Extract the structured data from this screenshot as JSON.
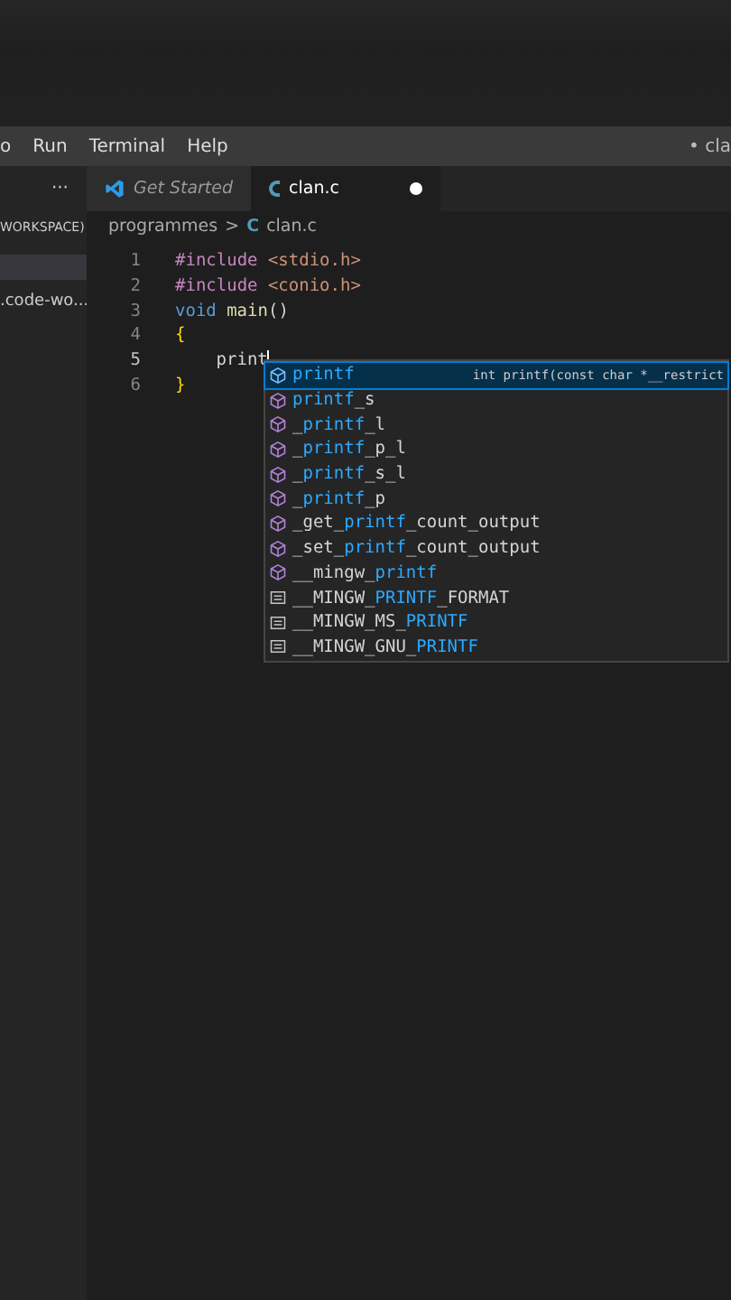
{
  "menu_bar": {
    "items": [
      "o",
      "Run",
      "Terminal",
      "Help"
    ],
    "title": "• cla"
  },
  "tabs": [
    {
      "label": "Get Started",
      "kind": "welcome",
      "selected": false,
      "dirty": false
    },
    {
      "label": "clan.c",
      "kind": "file",
      "selected": true,
      "dirty": true
    }
  ],
  "sidebar": {
    "items": [
      {
        "label": "WORKSPACE)",
        "selected": false
      },
      {
        "selected": true
      },
      {
        "label": ".code-wo...",
        "selected": false
      }
    ],
    "more": "···"
  },
  "breadcrumb": {
    "folder": "programmes",
    "separator": ">",
    "file_icon": "C",
    "file": "clan.c"
  },
  "editor": {
    "lines": [
      {
        "number": "1",
        "active": false,
        "tokens": [
          {
            "kind": "directive",
            "text": "#include"
          },
          {
            "kind": "string",
            "text": "<stdio.h>",
            "space_before": true
          }
        ]
      },
      {
        "number": "2",
        "active": false,
        "tokens": [
          {
            "kind": "directive",
            "text": "#include"
          },
          {
            "kind": "string",
            "text": "<conio.h>",
            "space_before": true
          }
        ]
      },
      {
        "number": "3",
        "active": false,
        "tokens": [
          {
            "kind": "keyword",
            "text": "void"
          },
          {
            "kind": "function",
            "text": "main",
            "space_before": true
          },
          {
            "kind": "text",
            "text": "()"
          }
        ]
      },
      {
        "number": "4",
        "active": false,
        "tokens": [
          {
            "kind": "bracket",
            "text": "{"
          }
        ]
      },
      {
        "number": "5",
        "active": true,
        "tokens": [
          {
            "kind": "text",
            "text": "print",
            "indent": true
          }
        ]
      },
      {
        "number": "6",
        "active": false,
        "tokens": [
          {
            "kind": "bracket",
            "text": "}"
          }
        ]
      }
    ]
  },
  "suggestions": {
    "detail": "int printf(const char *__restrict",
    "items": [
      {
        "kind": "method",
        "match": "printf",
        "selected": true
      },
      {
        "kind": "method",
        "match": "printf",
        "after": "_s",
        "selected": false
      },
      {
        "kind": "method",
        "before": "_",
        "match": "printf",
        "after": "_l",
        "selected": false
      },
      {
        "kind": "method",
        "before": "_",
        "match": "printf",
        "after": "_p_l",
        "selected": false
      },
      {
        "kind": "method",
        "before": "_",
        "match": "printf",
        "after": "_s_l",
        "selected": false
      },
      {
        "kind": "method",
        "before": "_",
        "match": "printf",
        "after": "_p",
        "selected": false
      },
      {
        "kind": "method",
        "before": "_get_",
        "match": "printf",
        "after": "_count_output",
        "selected": false
      },
      {
        "kind": "method",
        "before": "_set_",
        "match": "printf",
        "after": "_count_output",
        "selected": false
      },
      {
        "kind": "method",
        "before": "__mingw_",
        "match": "printf",
        "selected": false
      },
      {
        "kind": "constant",
        "before": "__MINGW_",
        "match": "PRINTF",
        "after": "_FORMAT",
        "selected": false
      },
      {
        "kind": "constant",
        "before": "__MINGW_MS_",
        "match": "PRINTF",
        "selected": false
      },
      {
        "kind": "constant",
        "before": "__MINGW_GNU_",
        "match": "PRINTF",
        "selected": false
      }
    ]
  }
}
